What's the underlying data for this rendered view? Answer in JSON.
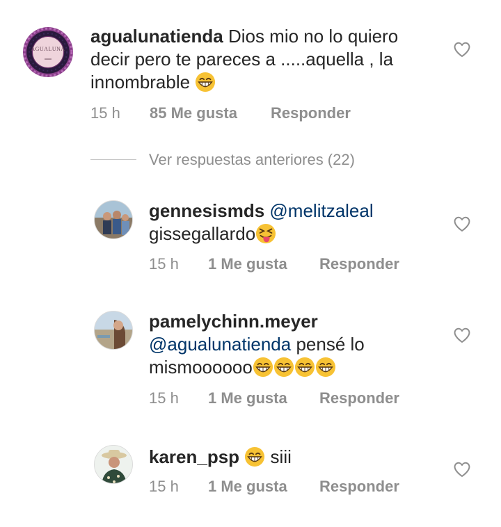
{
  "comments": [
    {
      "username": "agualunatienda",
      "text_parts": [
        "Dios mio no lo quiero",
        "decir pero te pareces a .....aquella , la",
        "innombrable"
      ],
      "emoji": "grinning-squinting-emoji",
      "time": "15 h",
      "likes": "85 Me gusta",
      "reply": "Responder",
      "avatar_text": "AGUALUNA"
    },
    {
      "username": "gennesismds",
      "mention": "@melitzaleal",
      "text": "gissegallardo",
      "emoji": "squinting-tongue-emoji",
      "time": "15 h",
      "likes": "1 Me gusta",
      "reply": "Responder"
    },
    {
      "username": "pamelychinn.meyer",
      "mention": "@agualunatienda",
      "text_after_mention": "pensé lo",
      "text": "mismoooooo",
      "emoji": "grinning-squinting-emoji",
      "time": "15 h",
      "likes": "1 Me gusta",
      "reply": "Responder"
    },
    {
      "username": "karen_psp",
      "text": "siii",
      "emoji": "grinning-squinting-emoji",
      "time": "15 h",
      "likes": "1 Me gusta",
      "reply": "Responder"
    }
  ],
  "view_previous": "Ver respuestas anteriores (22)",
  "colors": {
    "text": "#262626",
    "meta": "#8e8e8e",
    "mention": "#003569",
    "emoji": "#f7c234"
  }
}
